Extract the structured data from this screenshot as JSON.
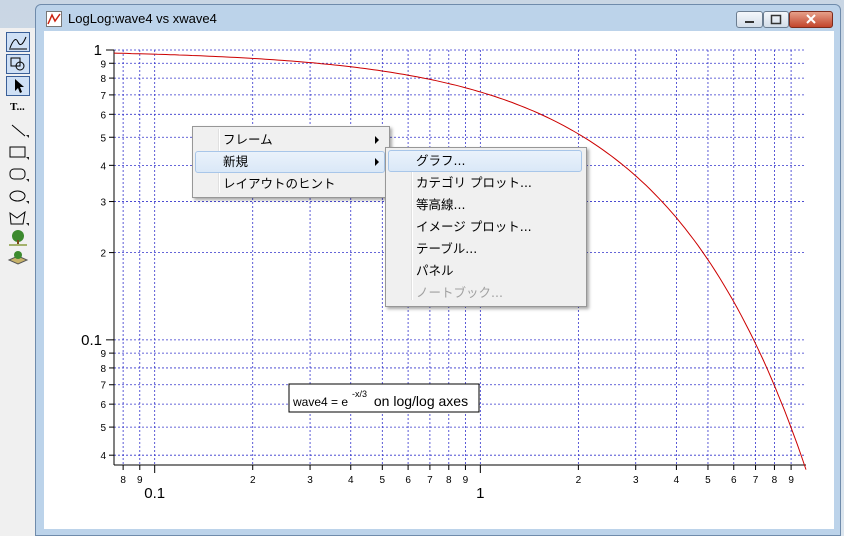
{
  "window": {
    "title": "LogLog:wave4 vs xwave4"
  },
  "toolbar": {
    "items": [
      "graph-mode-icon",
      "draw-mode-icon",
      "arrow-tool-icon",
      "text-tool-icon",
      "line-tool-icon",
      "rectangle-tool-icon",
      "rounded-rect-tool-icon",
      "oval-tool-icon",
      "polygon-tool-icon",
      "tree-picture-icon",
      "layer-picture-icon"
    ],
    "text_tool_label": "T..."
  },
  "context_menu": {
    "items": [
      {
        "label": "フレーム",
        "submenu": true
      },
      {
        "label": "新規",
        "submenu": true
      },
      {
        "label": "レイアウトのヒント",
        "submenu": false
      }
    ],
    "submenu": {
      "items": [
        {
          "label": "グラフ...",
          "enabled": true
        },
        {
          "label": "カテゴリ プロット...",
          "enabled": true
        },
        {
          "label": "等高線...",
          "enabled": true
        },
        {
          "label": "イメージ プロット...",
          "enabled": true
        },
        {
          "label": "テーブル...",
          "enabled": true
        },
        {
          "label": "パネル",
          "enabled": true
        },
        {
          "label": "ノートブック...",
          "enabled": false
        }
      ]
    }
  },
  "annotation": {
    "base": "wave4 = e",
    "exponent": "-x/3",
    "suffix": " on log/log axes"
  },
  "colors": {
    "trace": "#cc0000",
    "grid": "#3333cc",
    "highlight": "#dae8f7"
  },
  "chart_data": {
    "type": "line",
    "x_scale": "log",
    "y_scale": "log",
    "xlim": [
      0.075,
      10
    ],
    "ylim": [
      0.037,
      1
    ],
    "grid": true,
    "series": [
      {
        "name": "wave4",
        "function": "exp(-x/3)",
        "x": [
          0.075,
          0.1,
          0.2,
          0.3,
          0.5,
          0.7,
          1,
          1.5,
          2,
          3,
          4,
          5,
          6,
          7,
          8,
          9,
          10
        ],
        "y": [
          0.975,
          0.967,
          0.936,
          0.905,
          0.846,
          0.792,
          0.717,
          0.607,
          0.513,
          0.368,
          0.264,
          0.189,
          0.135,
          0.097,
          0.069,
          0.05,
          0.036
        ]
      }
    ],
    "x_ticks": [
      {
        "value": 0.08,
        "label": "8"
      },
      {
        "value": 0.09,
        "label": "9"
      },
      {
        "value": 0.1,
        "label": "0.1"
      },
      {
        "value": 0.2,
        "label": "2"
      },
      {
        "value": 0.3,
        "label": "3"
      },
      {
        "value": 0.4,
        "label": "4"
      },
      {
        "value": 0.5,
        "label": "5"
      },
      {
        "value": 0.6,
        "label": "6"
      },
      {
        "value": 0.7,
        "label": "7"
      },
      {
        "value": 0.8,
        "label": "8"
      },
      {
        "value": 0.9,
        "label": "9"
      },
      {
        "value": 1,
        "label": "1"
      },
      {
        "value": 2,
        "label": "2"
      },
      {
        "value": 3,
        "label": "3"
      },
      {
        "value": 4,
        "label": "4"
      },
      {
        "value": 5,
        "label": "5"
      },
      {
        "value": 6,
        "label": "6"
      },
      {
        "value": 7,
        "label": "7"
      },
      {
        "value": 8,
        "label": "8"
      },
      {
        "value": 9,
        "label": "9"
      }
    ],
    "y_ticks": [
      {
        "value": 1,
        "label": "1"
      },
      {
        "value": 0.9,
        "label": "9"
      },
      {
        "value": 0.8,
        "label": "8"
      },
      {
        "value": 0.7,
        "label": "7"
      },
      {
        "value": 0.6,
        "label": "6"
      },
      {
        "value": 0.5,
        "label": "5"
      },
      {
        "value": 0.4,
        "label": "4"
      },
      {
        "value": 0.3,
        "label": "3"
      },
      {
        "value": 0.2,
        "label": "2"
      },
      {
        "value": 0.1,
        "label": "0.1"
      },
      {
        "value": 0.09,
        "label": "9"
      },
      {
        "value": 0.08,
        "label": "8"
      },
      {
        "value": 0.07,
        "label": "7"
      },
      {
        "value": 0.06,
        "label": "6"
      },
      {
        "value": 0.05,
        "label": "5"
      },
      {
        "value": 0.04,
        "label": "4"
      }
    ]
  }
}
